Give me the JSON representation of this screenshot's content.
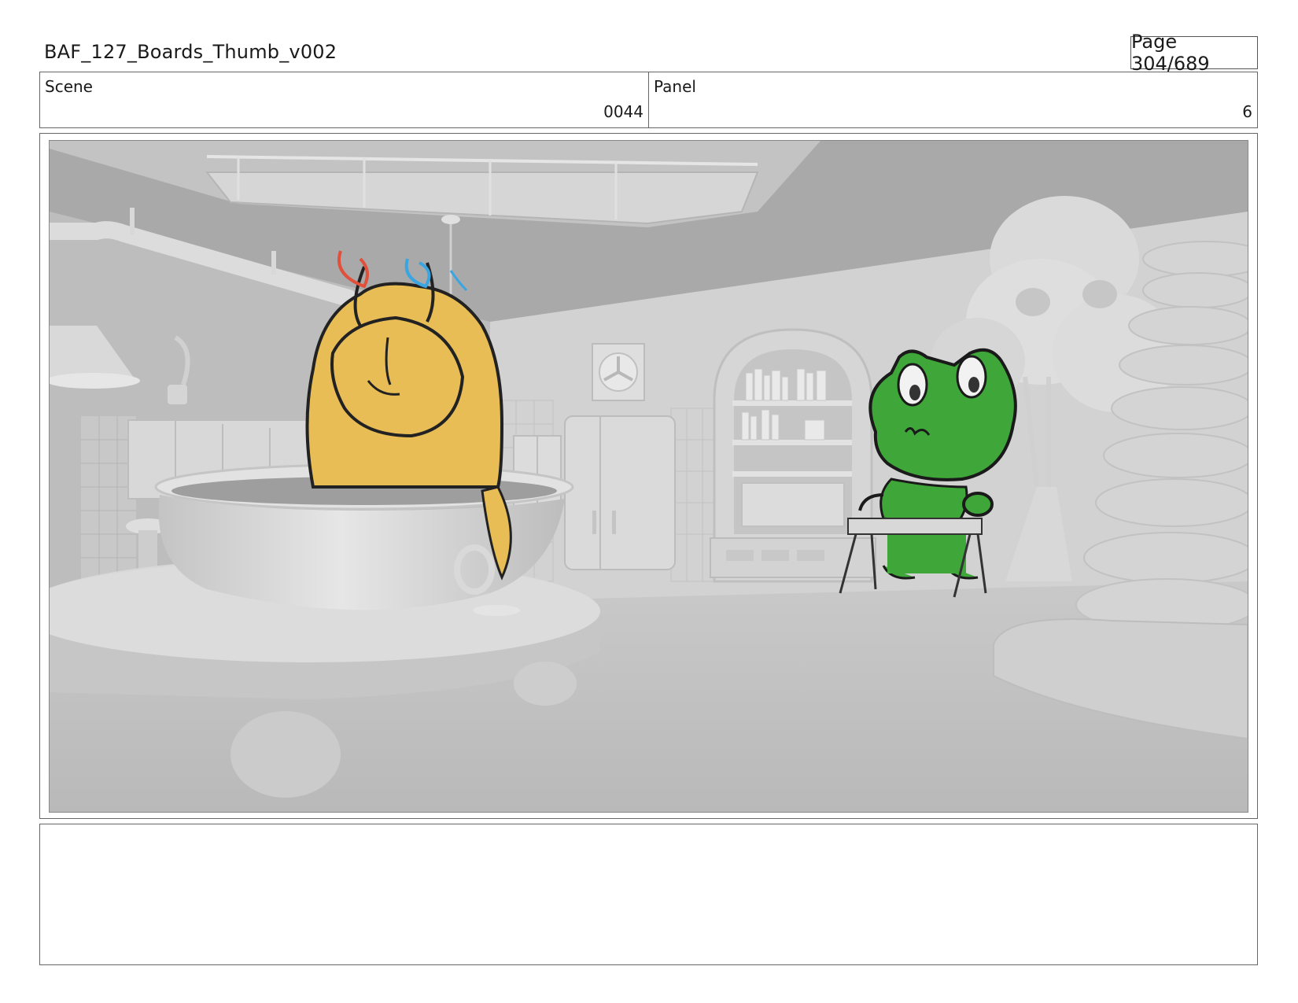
{
  "header": {
    "document_title": "BAF_127_Boards_Thumb_v002",
    "page_label": "Page 304/689"
  },
  "info": {
    "scene_label": "Scene",
    "scene_value": "0044",
    "panel_label": "Panel",
    "panel_value": "6"
  },
  "notes": {
    "text": ""
  },
  "colors": {
    "page_background": "#ffffff",
    "border": "#666666",
    "character_yellow": "#e8bd55",
    "character_green": "#3fa63a",
    "environment_gray": "#c8c8c8"
  }
}
